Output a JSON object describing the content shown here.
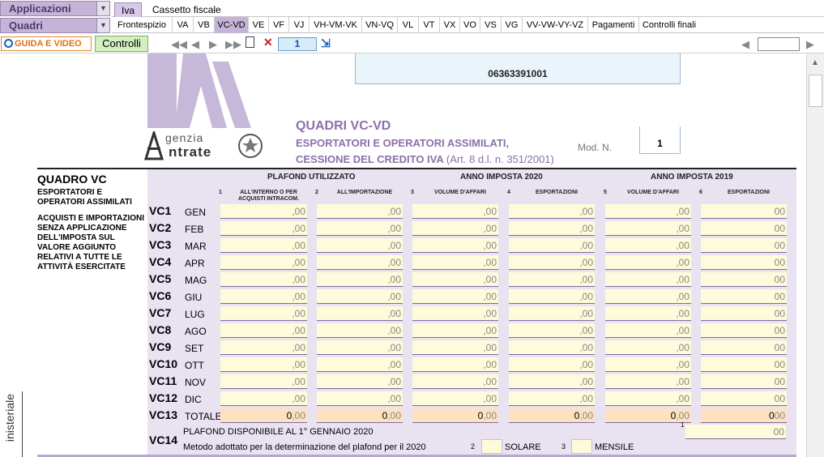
{
  "selectors": {
    "applicazioni": "Applicazioni",
    "quadri": "Quadri"
  },
  "top_tabs": [
    {
      "label": "Iva",
      "active": true
    },
    {
      "label": "Cassetto fiscale",
      "active": false
    }
  ],
  "quadri_tabs": [
    {
      "label": "Frontespizio"
    },
    {
      "label": "VA"
    },
    {
      "label": "VB"
    },
    {
      "label": "VC-VD",
      "active": true
    },
    {
      "label": "VE"
    },
    {
      "label": "VF"
    },
    {
      "label": "VJ"
    },
    {
      "label": "VH-VM-VK"
    },
    {
      "label": "VN-VQ"
    },
    {
      "label": "VL"
    },
    {
      "label": "VT"
    },
    {
      "label": "VX"
    },
    {
      "label": "VO"
    },
    {
      "label": "VS"
    },
    {
      "label": "VG"
    },
    {
      "label": "VV-VW-VY-VZ"
    },
    {
      "label": "Pagamenti"
    },
    {
      "label": "Controlli finali"
    }
  ],
  "toolbar": {
    "guida_label": "GUIDA E VIDEO",
    "controlli_label": "Controlli",
    "page_value": "1"
  },
  "form": {
    "codice_fiscale": "06363391001",
    "agenzia_line1": "genzia",
    "agenzia_line2": "ntrate",
    "title_line1": "QUADRI VC-VD",
    "title_line2": "ESPORTATORI E OPERATORI ASSIMILATI,",
    "title_line3": "CESSIONE DEL CREDITO IVA",
    "title_line3b": "(Art. 8 d.l. n. 351/2001)",
    "mod_label": "Mod. N.",
    "mod_value": "1",
    "quadro_title": "QUADRO VC",
    "quadro_sub1": "ESPORTATORI E OPERATORI ASSIMILATI",
    "quadro_sub2": "ACQUISTI E IMPORTAZIONI SENZA APPLICAZIONE DELL'IMPOSTA SUL VALORE AGGIUNTO RELATIVI A TUTTE LE ATTIVITÀ ESERCITATE",
    "group_headers": {
      "plafond": "PLAFOND UTILIZZATO",
      "anno2020": "ANNO IMPOSTA 2020",
      "anno2019": "ANNO IMPOSTA 2019"
    },
    "column_headers": [
      {
        "num": "1",
        "label": "ALL'INTERNO O PER ACQUISTI INTRACOM."
      },
      {
        "num": "2",
        "label": "ALL'IMPORTAZIONE"
      },
      {
        "num": "3",
        "label": "VOLUME D'AFFARI"
      },
      {
        "num": "4",
        "label": "ESPORTAZIONI"
      },
      {
        "num": "5",
        "label": "VOLUME D'AFFARI"
      },
      {
        "num": "6",
        "label": "ESPORTAZIONI"
      }
    ],
    "rows": [
      {
        "code": "VC1",
        "month": "GEN"
      },
      {
        "code": "VC2",
        "month": "FEB"
      },
      {
        "code": "VC3",
        "month": "MAR"
      },
      {
        "code": "VC4",
        "month": "APR"
      },
      {
        "code": "VC5",
        "month": "MAG"
      },
      {
        "code": "VC6",
        "month": "GIU"
      },
      {
        "code": "VC7",
        "month": "LUG"
      },
      {
        "code": "VC8",
        "month": "AGO"
      },
      {
        "code": "VC9",
        "month": "SET"
      },
      {
        "code": "VC10",
        "month": "OTT"
      },
      {
        "code": "VC11",
        "month": "NOV"
      },
      {
        "code": "VC12",
        "month": "DIC"
      }
    ],
    "cell_decimal": ",00",
    "cell_decimal_last": "00",
    "totale": {
      "code": "VC13",
      "label": "TOTALE",
      "value": "0",
      "decimal": ",00",
      "decimal_last": "00"
    },
    "vc14": {
      "code": "VC14",
      "line1": "PLAFOND DISPONIBILE AL 1° GENNAIO 2020",
      "line2": "Metodo adottato per la determinazione del plafond per il 2020",
      "field1_num": "1",
      "field1_decimal": "00",
      "opt2_num": "2",
      "opt2_label": "SOLARE",
      "opt3_num": "3",
      "opt3_label": "MENSILE"
    },
    "side_text": "inisteriale"
  }
}
